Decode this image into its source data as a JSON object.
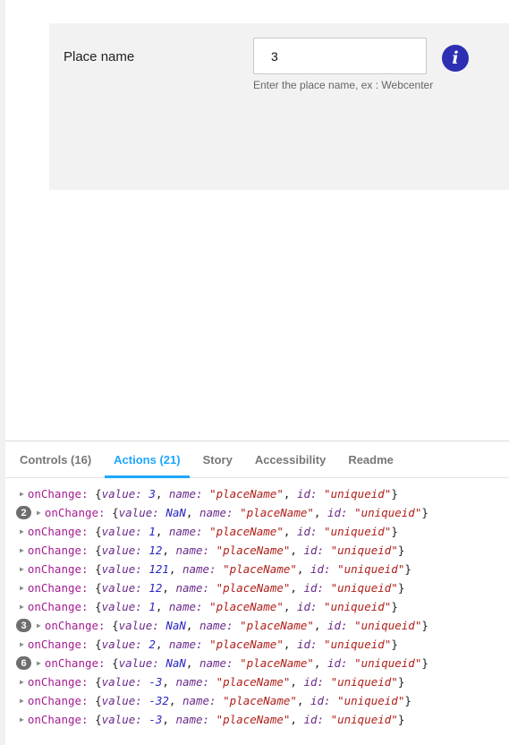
{
  "form": {
    "label": "Place name",
    "input_value": "3",
    "help_text": "Enter the place name, ex : Webcenter",
    "info_glyph": "i",
    "info_color": "#2c2fb2"
  },
  "tabs": [
    {
      "label": "Controls (16)",
      "active": false
    },
    {
      "label": "Actions (21)",
      "active": true
    },
    {
      "label": "Story",
      "active": false
    },
    {
      "label": "Accessibility",
      "active": false
    },
    {
      "label": "Readme",
      "active": false
    }
  ],
  "log_prefix": "onChange:",
  "log_keys": {
    "value": "value:",
    "name": "name:",
    "id": "id:"
  },
  "log": [
    {
      "count": "",
      "value": "3",
      "name": "\"placeName\"",
      "id": "\"uniqueid\""
    },
    {
      "count": "2",
      "value": "NaN",
      "name": "\"placeName\"",
      "id": "\"uniqueid\""
    },
    {
      "count": "",
      "value": "1",
      "name": "\"placeName\"",
      "id": "\"uniqueid\""
    },
    {
      "count": "",
      "value": "12",
      "name": "\"placeName\"",
      "id": "\"uniqueid\""
    },
    {
      "count": "",
      "value": "121",
      "name": "\"placeName\"",
      "id": "\"uniqueid\""
    },
    {
      "count": "",
      "value": "12",
      "name": "\"placeName\"",
      "id": "\"uniqueid\""
    },
    {
      "count": "",
      "value": "1",
      "name": "\"placeName\"",
      "id": "\"uniqueid\""
    },
    {
      "count": "3",
      "value": "NaN",
      "name": "\"placeName\"",
      "id": "\"uniqueid\""
    },
    {
      "count": "",
      "value": "2",
      "name": "\"placeName\"",
      "id": "\"uniqueid\""
    },
    {
      "count": "6",
      "value": "NaN",
      "name": "\"placeName\"",
      "id": "\"uniqueid\""
    },
    {
      "count": "",
      "value": "-3",
      "name": "\"placeName\"",
      "id": "\"uniqueid\""
    },
    {
      "count": "",
      "value": "-32",
      "name": "\"placeName\"",
      "id": "\"uniqueid\""
    },
    {
      "count": "",
      "value": "-3",
      "name": "\"placeName\"",
      "id": "\"uniqueid\""
    }
  ]
}
